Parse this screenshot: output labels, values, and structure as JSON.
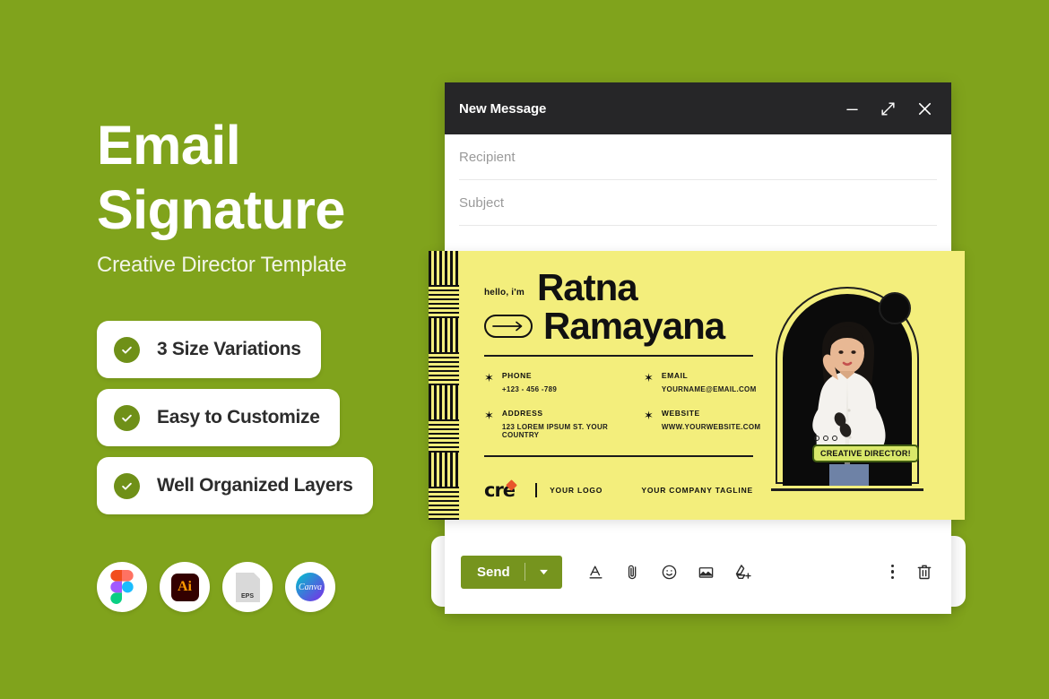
{
  "theme": {
    "background_green": "#80a31c",
    "card_yellow": "#f3ee7c",
    "titlebar_dark": "#262628",
    "send_green": "#76941e",
    "check_green": "#6f9018",
    "badge_green": "#d9e86a",
    "logo_accent": "#e8542a"
  },
  "hero": {
    "title_line1": "Email",
    "title_line2": "Signature",
    "subtitle": "Creative Director Template"
  },
  "features": [
    {
      "label": "3 Size Variations",
      "icon": "check-icon"
    },
    {
      "label": "Easy to Customize",
      "icon": "check-icon"
    },
    {
      "label": "Well Organized Layers",
      "icon": "check-icon"
    }
  ],
  "app_icons": [
    {
      "name": "figma-icon",
      "label": ""
    },
    {
      "name": "illustrator-icon",
      "label": "Ai"
    },
    {
      "name": "eps-file-icon",
      "label": "EPS"
    },
    {
      "name": "canva-icon",
      "label": "Canva"
    }
  ],
  "mail": {
    "title": "New Message",
    "window_controls": [
      {
        "name": "minimize-icon",
        "glyph": "minimize"
      },
      {
        "name": "expand-icon",
        "glyph": "expand"
      },
      {
        "name": "close-icon",
        "glyph": "close"
      }
    ],
    "fields": [
      {
        "name": "recipient-field",
        "placeholder": "Recipient",
        "value": ""
      },
      {
        "name": "subject-field",
        "placeholder": "Subject",
        "value": ""
      }
    ],
    "toolbar": {
      "send_label": "Send",
      "send_caret": "dropdown-caret-icon",
      "icons": [
        {
          "name": "format-text-icon"
        },
        {
          "name": "attach-file-icon"
        },
        {
          "name": "insert-emoji-icon"
        },
        {
          "name": "insert-image-icon"
        },
        {
          "name": "insert-drive-icon"
        }
      ],
      "right_icons": [
        {
          "name": "more-options-icon"
        },
        {
          "name": "discard-draft-icon"
        }
      ]
    }
  },
  "signature": {
    "greeting": "hello, i'm",
    "first_name": "Ratna",
    "last_name": "Ramayana",
    "arrow_icon": "arrow-right-icon",
    "contacts": [
      {
        "icon": "asterisk-icon",
        "label": "PHONE",
        "value": "+123 - 456 -789"
      },
      {
        "icon": "asterisk-icon",
        "label": "EMAIL",
        "value": "YOURNAME@EMAIL.COM"
      },
      {
        "icon": "asterisk-icon",
        "label": "ADDRESS",
        "value": "123 LOREM IPSUM ST. YOUR COUNTRY"
      },
      {
        "icon": "asterisk-icon",
        "label": "WEBSITE",
        "value": "WWW.YOURWEBSITE.COM"
      }
    ],
    "footer": {
      "logo_mark": "cre",
      "logo_text": "YOUR LOGO",
      "tagline": "YOUR COMPANY TAGLINE"
    },
    "photo": {
      "role_badge": "CREATIVE DIRECTOR!",
      "alt": "portrait-photo"
    }
  }
}
